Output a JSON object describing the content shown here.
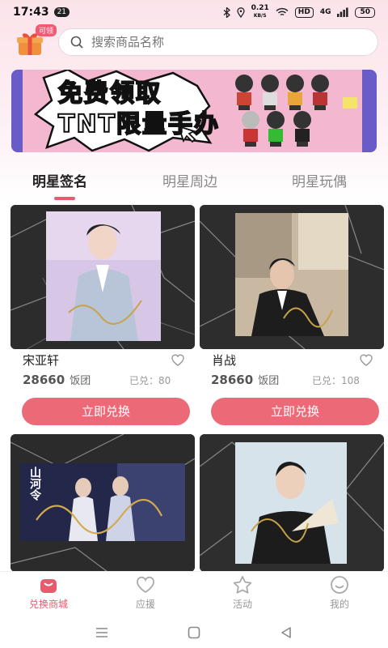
{
  "status_bar": {
    "time": "17:43",
    "notification_count": "21",
    "net_speed_value": "0.21",
    "net_speed_unit": "KB/S",
    "hd_label": "HD",
    "signal_label": "4G",
    "battery": "50"
  },
  "header": {
    "gift_tag": "可领",
    "search_placeholder": "搜索商品名称"
  },
  "banner": {
    "line1": "免费领取",
    "line2": "TNT限量手办"
  },
  "tabs": [
    {
      "label": "明星签名",
      "active": true
    },
    {
      "label": "明星周边",
      "active": false
    },
    {
      "label": "明星玩偶",
      "active": false
    }
  ],
  "products": [
    {
      "name": "宋亚轩",
      "price": "28660",
      "currency": "饭团",
      "stock": "已兑：80",
      "button": "立即兑换"
    },
    {
      "name": "肖战",
      "price": "28660",
      "currency": "饭团",
      "stock": "已兑：108",
      "button": "立即兑换"
    },
    {
      "card_text": "山河令"
    }
  ],
  "bottom_nav": [
    {
      "label": "兑换商城",
      "icon": "shop-bag-icon",
      "active": true
    },
    {
      "label": "应援",
      "icon": "heart-icon",
      "active": false
    },
    {
      "label": "活动",
      "icon": "star-icon",
      "active": false
    },
    {
      "label": "我的",
      "icon": "smile-icon",
      "active": false
    }
  ],
  "colors": {
    "accent": "#e85b6e",
    "button": "#ec6a78",
    "header_bg": "#fbe3ea"
  }
}
